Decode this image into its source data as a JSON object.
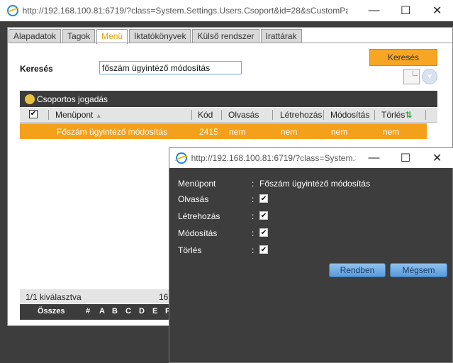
{
  "window": {
    "url": "http://192.168.100.81:6719/?class=System.Settings.Users.Csoport&id=28&sCustomPara..."
  },
  "tabs": [
    {
      "label": "Alapadatok"
    },
    {
      "label": "Tagok"
    },
    {
      "label": "Menü"
    },
    {
      "label": "Iktatókönyvek"
    },
    {
      "label": "Külső rendszer"
    },
    {
      "label": "Irattárak"
    }
  ],
  "search": {
    "label": "Keresés",
    "value": "főszám ügyintéző módosítás",
    "button": "Keresés"
  },
  "grid": {
    "title": "Csoportos jogadás",
    "columns": [
      "Menüpont",
      "Kód",
      "Olvasás",
      "Létrehozás",
      "Módosítás",
      "Törlés"
    ],
    "rows": [
      {
        "menupont": "Főszám ügyintéző módosítás",
        "kod": "2415",
        "olvasas": "nem",
        "letrehozas": "nem",
        "modositas": "nem",
        "torles": "nem"
      }
    ],
    "footer_selected": "1/1 kiválasztva",
    "footer_count": "16",
    "alpha": [
      "Összes",
      "#",
      "A",
      "B",
      "C",
      "D",
      "E",
      "F"
    ]
  },
  "dialog": {
    "url": "http://192.168.100.81:6719/?class=System.S...",
    "fields": [
      {
        "label": "Menüpont",
        "value": "Főszám ügyintéző módosítás"
      },
      {
        "label": "Olvasás",
        "checked": true
      },
      {
        "label": "Létrehozás",
        "checked": true
      },
      {
        "label": "Módosítás",
        "checked": true
      },
      {
        "label": "Törlés",
        "checked": true
      }
    ],
    "ok_button": "Rendben",
    "cancel_button": "Mégsem"
  },
  "colors": {
    "accent": "#f5a01a",
    "dark": "#3c3c3c",
    "button_blue": "#5a9ad8"
  }
}
